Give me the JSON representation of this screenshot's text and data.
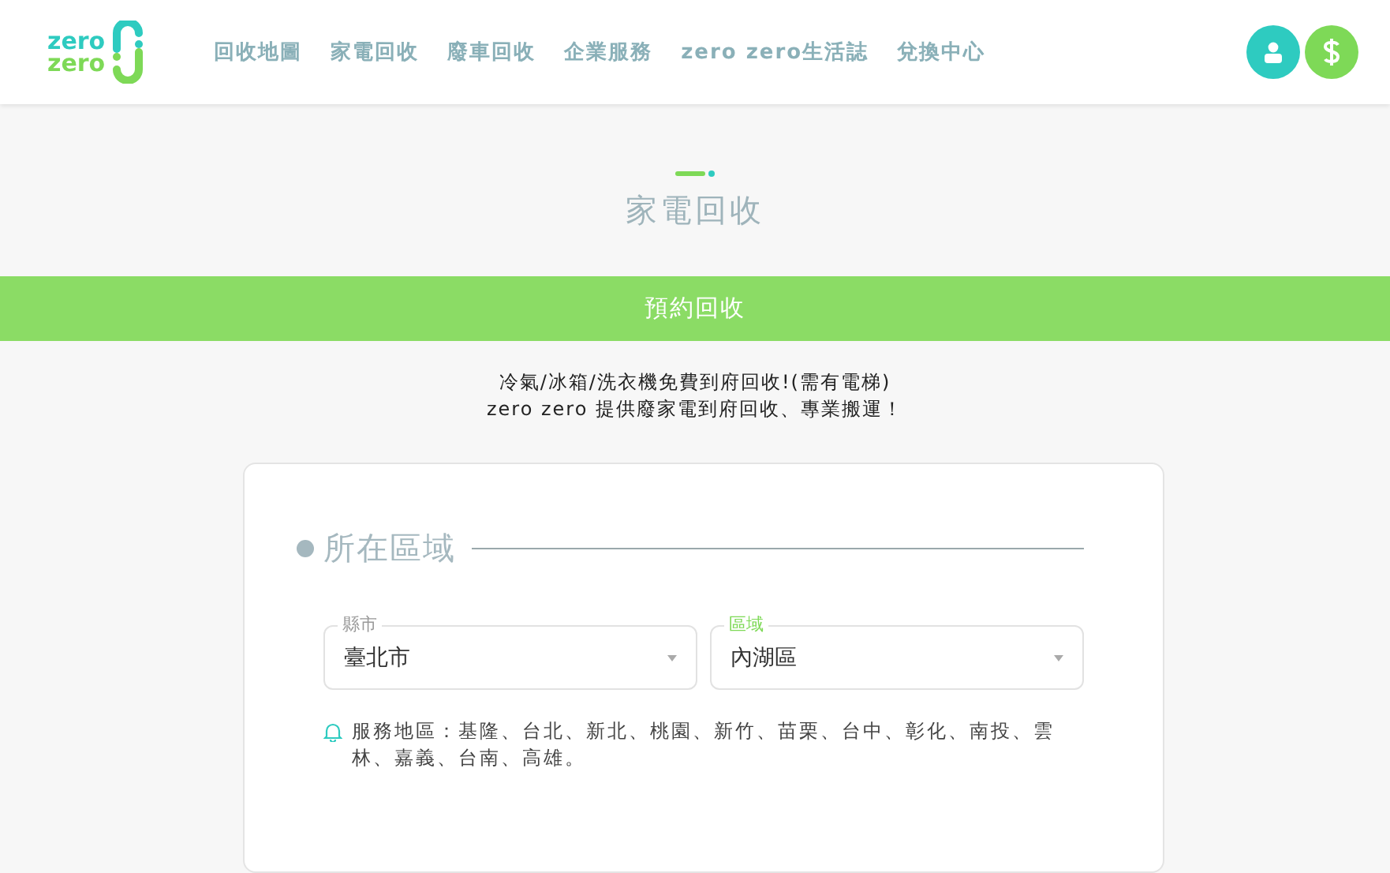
{
  "logo": {
    "lines": [
      "zero",
      "zero"
    ]
  },
  "nav": [
    {
      "label": "回收地圖"
    },
    {
      "label": "家電回收"
    },
    {
      "label": "廢車回收"
    },
    {
      "label": "企業服務"
    },
    {
      "label": "zero zero生活誌"
    },
    {
      "label": "兌換中心"
    }
  ],
  "page_title": "家電回收",
  "banner": "預約回收",
  "intro": [
    "冷氣/冰箱/洗衣機免費到府回收!(需有電梯)",
    "zero zero 提供廢家電到府回收、專業搬運！"
  ],
  "section": {
    "heading": "所在區域",
    "fields": [
      {
        "label": "縣市",
        "value": "臺北市",
        "focused": false
      },
      {
        "label": "區域",
        "value": "內湖區",
        "focused": true
      }
    ],
    "note": "服務地區：基隆、台北、新北、桃園、新竹、苗栗、台中、彰化、南投、雲林、嘉義、台南、高雄。"
  }
}
